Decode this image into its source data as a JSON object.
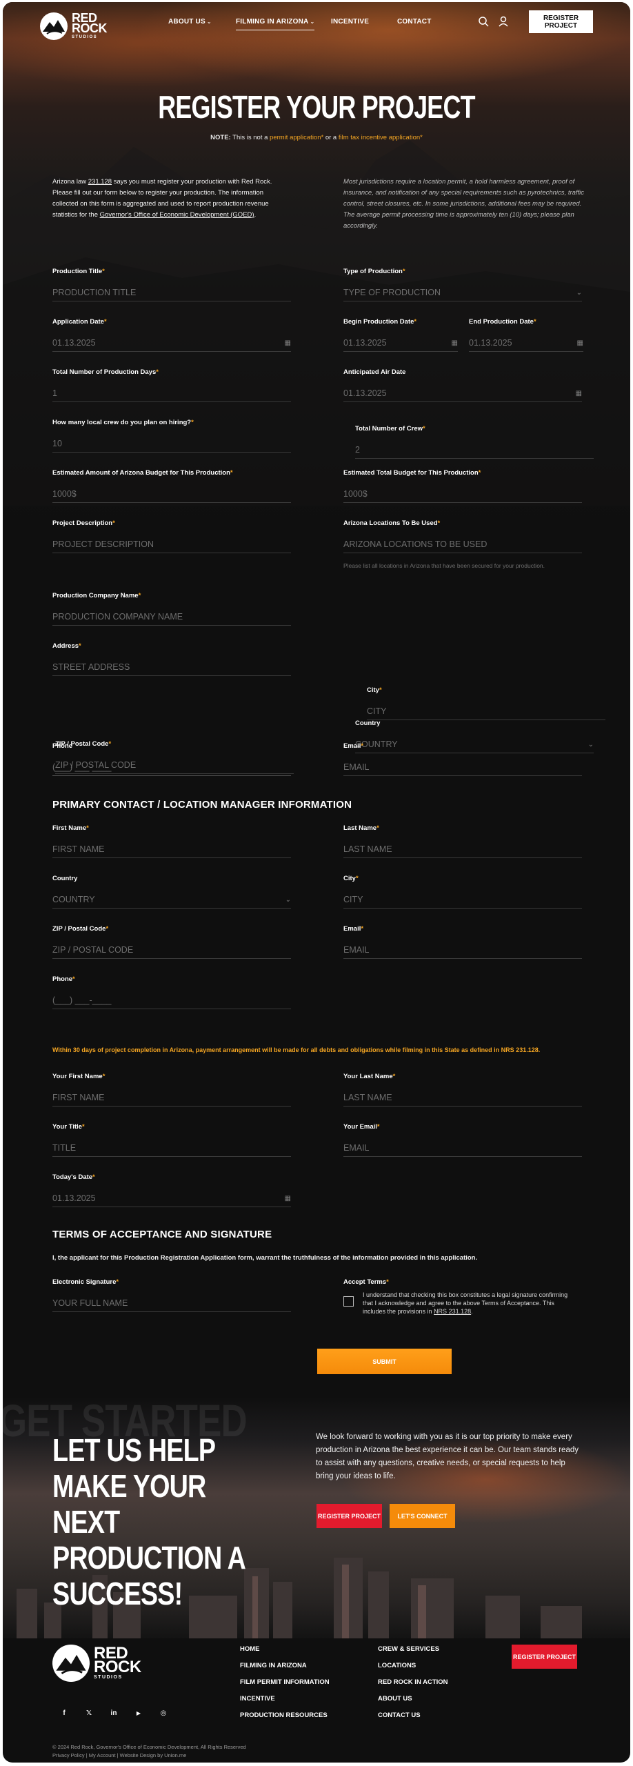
{
  "header": {
    "logo": {
      "line1": "RED",
      "line2": "ROCK",
      "line3": "STUDIOS"
    },
    "nav": [
      {
        "label": "ABOUT US",
        "has_dropdown": true
      },
      {
        "label": "FILMING IN ARIZONA",
        "has_dropdown": true,
        "active": true
      },
      {
        "label": "INCENTIVE",
        "has_dropdown": false
      },
      {
        "label": "CONTACT",
        "has_dropdown": false
      }
    ],
    "icons": [
      "search-icon",
      "user-icon"
    ],
    "register_button": "REGISTER PROJECT"
  },
  "hero": {
    "title": "REGISTER YOUR PROJECT",
    "note_prefix": "NOTE:",
    "note_mid1": " This is not a ",
    "note_link1": "permit application*",
    "note_mid2": " or a ",
    "note_link2": "film tax incentive application*"
  },
  "intro": {
    "left_1": "Arizona law ",
    "left_link1": "231.128",
    "left_2": " says you must register your production with Red Rock. Please fill out our form below to register your production. The information collected on this form is aggregated and used to report production revenue statistics for the ",
    "left_link2": "Governor's Office of Economic Development (GOED)",
    "left_3": ".",
    "right": "Most jurisdictions require a location permit, a hold harmless agreement, proof of insurance, and notification of any special requirements such as pyrotechnics, traffic control, street closures, etc. In some jurisdictions, additional fees may be required. The average permit processing time is approximately ten (10) days; please plan accordingly."
  },
  "form": {
    "production_title": {
      "label": "Production Title",
      "placeholder": "PRODUCTION TITLE"
    },
    "type_of_production": {
      "label": "Type of Production",
      "placeholder": "TYPE OF PRODUCTION"
    },
    "application_date": {
      "label": "Application Date",
      "value": "01.13.2025"
    },
    "begin_production_date": {
      "label": "Begin Production Date",
      "value": "01.13.2025"
    },
    "end_production_date": {
      "label": "End Production Date",
      "value": "01.13.2025"
    },
    "total_production_days": {
      "label": "Total Number of Production Days",
      "value": "1"
    },
    "anticipated_air_date": {
      "label": "Anticipated Air Date",
      "value": "01.13.2025"
    },
    "local_crew": {
      "label": "How many local crew do you plan on hiring?",
      "value": "10"
    },
    "total_crew": {
      "label": "Total Number of Crew",
      "value": "2"
    },
    "arizona_budget": {
      "label": "Estimated Amount of Arizona Budget for This Production",
      "value": "1000$"
    },
    "total_budget": {
      "label": "Estimated Total Budget for This Production",
      "value": "1000$"
    },
    "project_description": {
      "label": "Project Description",
      "placeholder": "PROJECT DESCRIPTION"
    },
    "arizona_locations": {
      "label": "Arizona Locations To Be Used",
      "placeholder": "ARIZONA LOCATIONS TO BE USED",
      "hint": "Please list all locations in Arizona that have been secured for your production."
    },
    "company_name": {
      "label": "Production Company Name",
      "placeholder": "PRODUCTION COMPANY NAME"
    },
    "address": {
      "label": "Address",
      "placeholder": "STREET ADDRESS"
    },
    "city": {
      "label": "City",
      "placeholder": "CITY"
    },
    "country": {
      "label": "Country",
      "placeholder": "COUNTRY"
    },
    "zip": {
      "label": "ZIP / Postal Code",
      "placeholder": "ZIP / POSTAL CODE"
    },
    "phone_overlap": {
      "label": "Phone",
      "placeholder": "(___) ___-____"
    },
    "email": {
      "label": "Email",
      "placeholder": "EMAIL"
    }
  },
  "primary_contact": {
    "title": "PRIMARY CONTACT / LOCATION MANAGER INFORMATION",
    "first_name": {
      "label": "First Name",
      "placeholder": "FIRST NAME"
    },
    "last_name": {
      "label": "Last Name",
      "placeholder": "LAST NAME"
    },
    "country": {
      "label": "Country",
      "placeholder": "COUNTRY"
    },
    "city": {
      "label": "City",
      "placeholder": "CITY"
    },
    "zip": {
      "label": "ZIP / Postal Code",
      "placeholder": "ZIP / POSTAL CODE"
    },
    "email": {
      "label": "Email",
      "placeholder": "EMAIL"
    },
    "phone": {
      "label": "Phone",
      "placeholder": "(___) ___-____"
    }
  },
  "payment_note": "Within 30 days of project completion in Arizona, payment arrangement will be made for all debts and obligations while filming in this State as defined in NRS 231.128.",
  "signer": {
    "first_name": {
      "label": "Your First Name",
      "placeholder": "FIRST NAME"
    },
    "last_name": {
      "label": "Your Last Name",
      "placeholder": "LAST NAME"
    },
    "title": {
      "label": "Your Title",
      "placeholder": "TITLE"
    },
    "email": {
      "label": "Your Email",
      "placeholder": "EMAIL"
    },
    "date": {
      "label": "Today's Date",
      "value": "01.13.2025"
    }
  },
  "terms": {
    "title": "TERMS OF ACCEPTANCE AND SIGNATURE",
    "statement": "I, the applicant for this Production Registration Application form, warrant the truthfulness of the information provided in this application.",
    "signature": {
      "label": "Electronic Signature",
      "placeholder": "YOUR FULL NAME"
    },
    "accept_label": "Accept Terms",
    "accept_text": "I understand that checking this box constitutes a legal signature confirming that I acknowledge and agree to the above Terms of Acceptance. This includes the provisions in ",
    "accept_link": "NRS 231.128",
    "accept_end": ".",
    "submit": "SUBMIT"
  },
  "cta": {
    "watermark": "GET STARTED",
    "title": "LET US HELP MAKE YOUR NEXT PRODUCTION A SUCCESS!",
    "text": "We look forward to working with you as it is our top priority to make every production in Arizona the best experience it can be. Our team stands ready to assist with any questions, creative needs, or special requests to help bring your ideas to life.",
    "button_register": "REGISTER PROJECT",
    "button_connect": "LET'S CONNECT"
  },
  "footer": {
    "col1": [
      "HOME",
      "FILMING IN ARIZONA",
      "FILM PERMIT INFORMATION",
      "INCENTIVE",
      "PRODUCTION RESOURCES"
    ],
    "col2": [
      "CREW & SERVICES",
      "LOCATIONS",
      "RED ROCK IN ACTION",
      "ABOUT US",
      "CONTACT US"
    ],
    "register_button": "REGISTER PROJECT",
    "social": [
      "f",
      "𝕏",
      "in",
      "▶",
      "◎"
    ],
    "copyright": "© 2024 Red Rock, Governor's Office of Economic Development, All Rights Reserved",
    "legal_links": "Privacy Policy | My Account | Website Design by Union.me"
  },
  "colors": {
    "accent": "#f5a623",
    "red": "#e31b2d",
    "bg": "#0f0f0f"
  }
}
